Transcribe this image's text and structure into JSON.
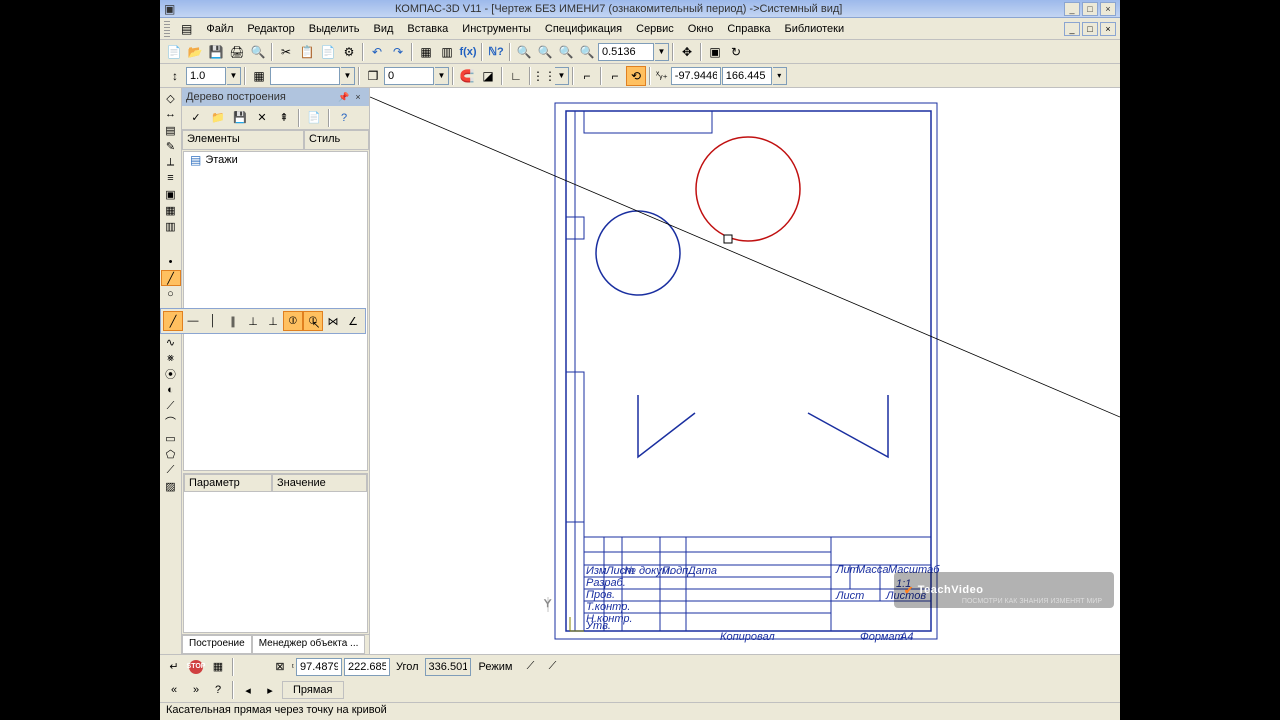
{
  "title": "КОМПАС-3D V11 - [Чертеж БЕЗ ИМЕНИ7 (ознакомительный период) ->Системный вид]",
  "menu": [
    "Файл",
    "Редактор",
    "Выделить",
    "Вид",
    "Вставка",
    "Инструменты",
    "Спецификация",
    "Сервис",
    "Окно",
    "Справка",
    "Библиотеки"
  ],
  "zoom_value": "0.5136",
  "scale_value": "1.0",
  "layer_value": "0",
  "coord_x": "-97.9446",
  "coord_y": "166.445",
  "panel_title": "Дерево построения",
  "tree_cols": {
    "c1": "Элементы",
    "c2": "Стиль"
  },
  "tree_item": "Этажи",
  "prop_cols": {
    "c1": "Параметр",
    "c2": "Значение"
  },
  "panel_tabs": {
    "t1": "Построение",
    "t2": "Менеджер объекта ..."
  },
  "bb_x": "97.4879",
  "bb_y": "222.685",
  "bb_angle_label": "Угол",
  "bb_angle": "336.501",
  "bb_mode_label": "Режим",
  "bb_tab": "Прямая",
  "status": "Касательная прямая через точку на кривой",
  "logo": "TeachVideo",
  "logo_sub": "ПОСМОТРИ КАК ЗНАНИЯ ИЗМЕНЯТ МИР",
  "titleblock": {
    "r1c1": "Изм",
    "r1c2": "Лист",
    "r1c3": "№ докум.",
    "r1c4": "Подп.",
    "r1c5": "Дата",
    "r2": "Разраб.",
    "r3": "Пров.",
    "r4": "Т.контр.",
    "r5": "Н.контр.",
    "r6": "Утв.",
    "lit": "Лит.",
    "massa": "Масса",
    "mash": "Масштаб",
    "scale": "1:1",
    "list": "Лист",
    "listov": "Листов",
    "kop": "Копировал",
    "fmt": "Формат",
    "fmtv": "A4"
  }
}
